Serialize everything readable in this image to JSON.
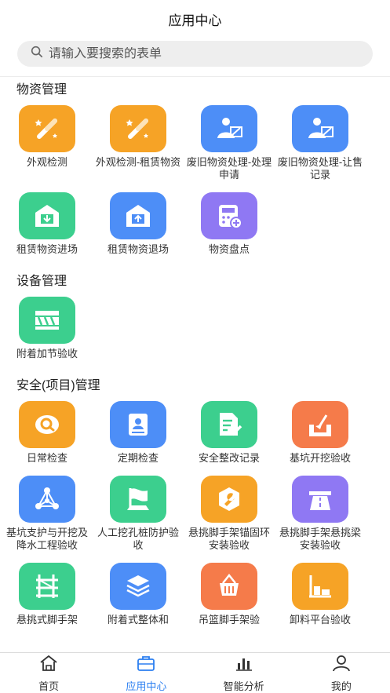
{
  "header": {
    "title": "应用中心"
  },
  "search": {
    "placeholder": "请输入要搜索的表单"
  },
  "colors": {
    "orange": "#f6a326",
    "blue": "#4d8ef7",
    "green": "#3ccf8e",
    "purple": "#8f78f3",
    "red_orange": "#f57b4a",
    "accent": "#2b7ff1"
  },
  "sections": [
    {
      "title": "物资管理",
      "apps": [
        {
          "label": "外观检测",
          "icon": "magic-wand-icon",
          "color": "#f6a326"
        },
        {
          "label": "外观检测-租赁物资",
          "icon": "magic-wand-icon",
          "color": "#f6a326"
        },
        {
          "label": "废旧物资处理-处理申请",
          "icon": "person-edit-icon",
          "color": "#4d8ef7"
        },
        {
          "label": "废旧物资处理-让售记录",
          "icon": "person-edit-icon",
          "color": "#4d8ef7"
        },
        {
          "label": "租赁物资进场",
          "icon": "warehouse-in-icon",
          "color": "#3ccf8e"
        },
        {
          "label": "租赁物资退场",
          "icon": "warehouse-out-icon",
          "color": "#4d8ef7"
        },
        {
          "label": "物资盘点",
          "icon": "calculator-icon",
          "color": "#8f78f3"
        }
      ]
    },
    {
      "title": "设备管理",
      "apps": [
        {
          "label": "附着加节验收",
          "icon": "barrier-icon",
          "color": "#3ccf8e"
        }
      ]
    },
    {
      "title": "安全(项目)管理",
      "apps": [
        {
          "label": "日常检查",
          "icon": "search-circle-icon",
          "color": "#f6a326"
        },
        {
          "label": "定期检查",
          "icon": "calendar-user-icon",
          "color": "#4d8ef7"
        },
        {
          "label": "安全整改记录",
          "icon": "document-edit-icon",
          "color": "#3ccf8e"
        },
        {
          "label": "基坑开挖验收",
          "icon": "excavation-icon",
          "color": "#f57b4a"
        },
        {
          "label": "基坑支护与开挖及降水工程验收",
          "icon": "network-icon",
          "color": "#4d8ef7"
        },
        {
          "label": "人工挖孔桩防护验收",
          "icon": "flag-icon",
          "color": "#3ccf8e"
        },
        {
          "label": "悬挑脚手架锚固环安装验收",
          "icon": "wrench-icon",
          "color": "#f6a326"
        },
        {
          "label": "悬挑脚手架悬挑梁安装验收",
          "icon": "road-icon",
          "color": "#8f78f3"
        },
        {
          "label": "悬挑式脚手架",
          "icon": "scaffold-icon",
          "color": "#3ccf8e"
        },
        {
          "label": "附着式整体和",
          "icon": "layers-icon",
          "color": "#4d8ef7"
        },
        {
          "label": "吊篮脚手架验",
          "icon": "basket-icon",
          "color": "#f57b4a"
        },
        {
          "label": "卸料平台验收",
          "icon": "platform-icon",
          "color": "#f6a326"
        }
      ]
    }
  ],
  "tabs": [
    {
      "label": "首页",
      "icon": "home-icon",
      "active": false
    },
    {
      "label": "应用中心",
      "icon": "briefcase-icon",
      "active": true
    },
    {
      "label": "智能分析",
      "icon": "bar-chart-icon",
      "active": false
    },
    {
      "label": "我的",
      "icon": "user-icon",
      "active": false
    }
  ]
}
